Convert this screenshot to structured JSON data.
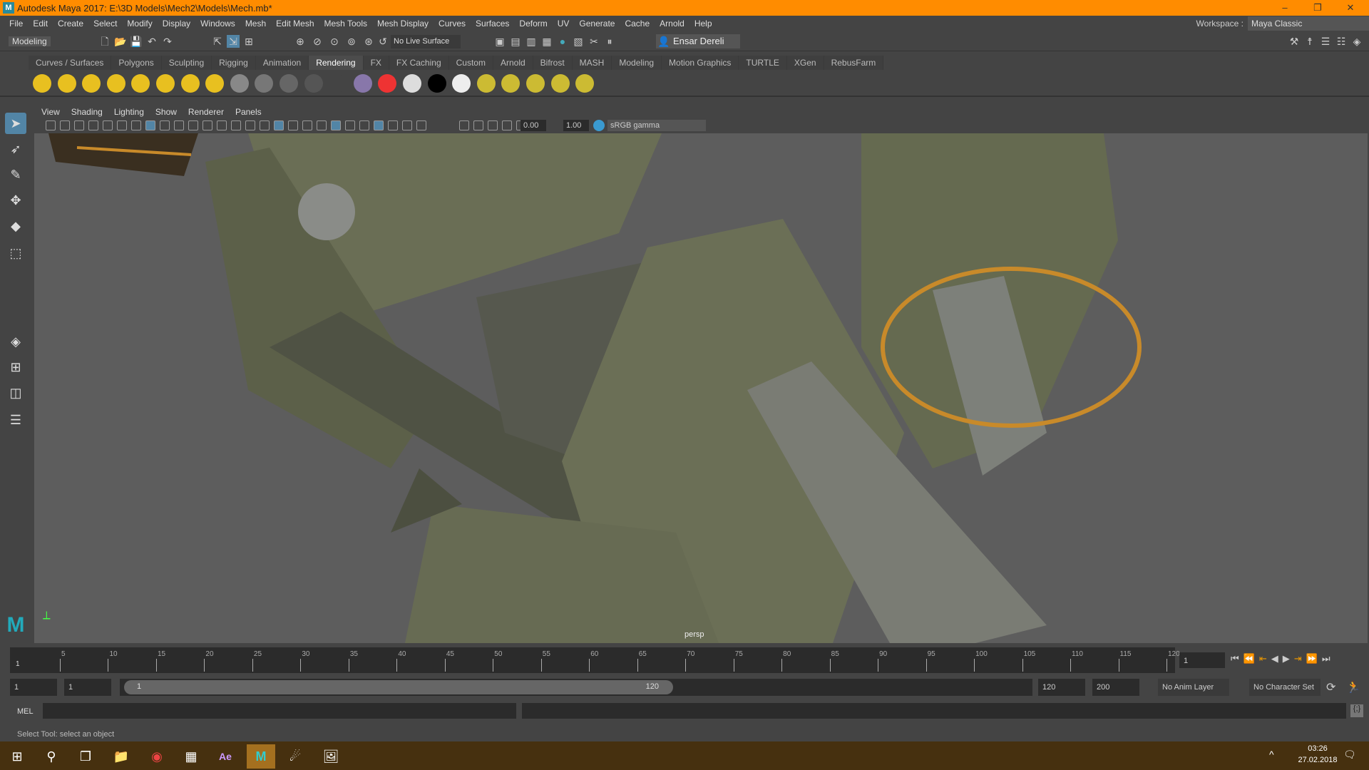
{
  "window": {
    "title": "Autodesk Maya 2017: E:\\3D Models\\Mech2\\Models\\Mech.mb*",
    "logo": "M",
    "minimize": "–",
    "restore": "❐",
    "close": "✕"
  },
  "menu": [
    "File",
    "Edit",
    "Create",
    "Select",
    "Modify",
    "Display",
    "Windows",
    "Mesh",
    "Edit Mesh",
    "Mesh Tools",
    "Mesh Display",
    "Curves",
    "Surfaces",
    "Deform",
    "UV",
    "Generate",
    "Cache",
    "Arnold",
    "Help"
  ],
  "workspace": {
    "label": "Workspace :",
    "value": "Maya Classic"
  },
  "statusline": {
    "menuset": "Modeling",
    "live_surface": "No Live Surface",
    "user": "Ensar Dereli"
  },
  "shelf_tabs": [
    "Curves / Surfaces",
    "Polygons",
    "Sculpting",
    "Rigging",
    "Animation",
    "Rendering",
    "FX",
    "FX Caching",
    "Custom",
    "Arnold",
    "Bifrost",
    "MASH",
    "Modeling",
    "Motion Graphics",
    "TURTLE",
    "XGen",
    "RebusFarm"
  ],
  "active_shelf": "Rendering",
  "panel_menu": [
    "View",
    "Shading",
    "Lighting",
    "Show",
    "Renderer",
    "Panels"
  ],
  "panel_toolbar": {
    "exposure": "0.00",
    "gamma": "1.00",
    "color_space": "sRGB gamma"
  },
  "viewport": {
    "camera": "persp"
  },
  "timeline": {
    "ticks": [
      "5",
      "10",
      "15",
      "20",
      "25",
      "30",
      "35",
      "40",
      "45",
      "50",
      "55",
      "60",
      "65",
      "70",
      "75",
      "80",
      "85",
      "90",
      "95",
      "100",
      "105",
      "110",
      "115",
      "120"
    ],
    "current_frame_marker": "1",
    "current_frame": "1"
  },
  "range": {
    "start": "1",
    "playback_start": "1",
    "slider_start": "1",
    "slider_end": "120",
    "playback_end": "120",
    "end": "200",
    "anim_layer": "No Anim Layer",
    "character_set": "No Character Set"
  },
  "mel": {
    "label": "MEL"
  },
  "help_line": "Select Tool: select an object",
  "taskbar": {
    "time": "03:26",
    "date": "27.02.2018"
  },
  "colors": {
    "title_bar": "#ff8c00",
    "taskbar": "#46300f",
    "active_tool": "#5285a6"
  }
}
